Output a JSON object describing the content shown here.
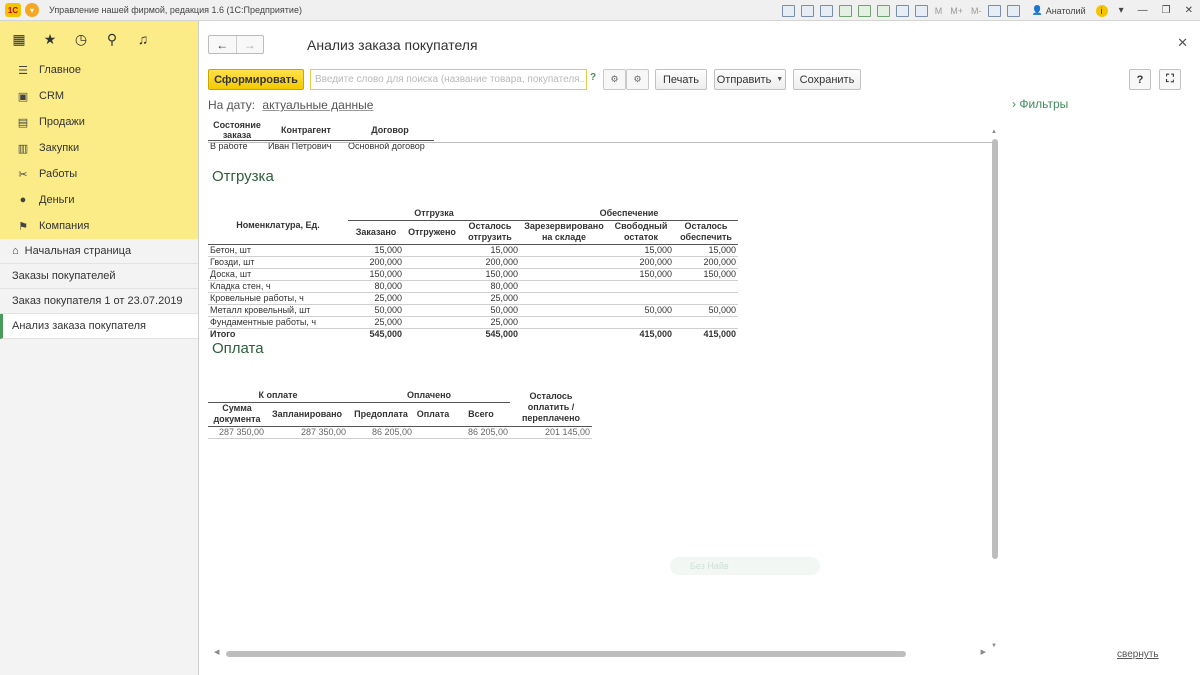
{
  "window": {
    "title": "Управление нашей фирмой, редакция 1.6  (1С:Предприятие)",
    "logo": "1С",
    "user": "Анатолий",
    "m_labels": [
      "M",
      "M+",
      "M-"
    ]
  },
  "sidebar": {
    "items": [
      {
        "label": "Главное",
        "icon": "menu-lines-icon"
      },
      {
        "label": "CRM",
        "icon": "crm-icon"
      },
      {
        "label": "Продажи",
        "icon": "cart-icon"
      },
      {
        "label": "Закупки",
        "icon": "purchases-icon"
      },
      {
        "label": "Работы",
        "icon": "tools-icon"
      },
      {
        "label": "Деньги",
        "icon": "money-icon"
      },
      {
        "label": "Компания",
        "icon": "flag-icon"
      }
    ],
    "nav": [
      {
        "label": "Начальная страница"
      },
      {
        "label": "Заказы покупателей"
      },
      {
        "label": "Заказ покупателя 1 от 23.07.2019"
      },
      {
        "label": "Анализ заказа покупателя"
      }
    ]
  },
  "main": {
    "title": "Анализ заказа покупателя",
    "toolbar": {
      "generate": "Сформировать",
      "search_placeholder": "Введите слово для поиска (название товара, покупателя...",
      "help_mark": "?",
      "print": "Печать",
      "send": "Отправить",
      "save": "Сохранить",
      "help": "?"
    },
    "date_label": "На дату:",
    "date_value": "актуальные данные",
    "filters": "Фильтры",
    "collapse": "свернуть",
    "ghost_text": "Без Найв"
  },
  "report": {
    "header_table": {
      "columns": [
        "Состояние заказа",
        "Контрагент",
        "Договор"
      ],
      "row": [
        "В работе",
        "Иван Петрович",
        "Основной договор"
      ]
    },
    "shipment": {
      "title": "Отгрузка",
      "col_item": "Номенклатура, Ед.",
      "group_shipment": "Отгрузка",
      "group_provision": "Обеспечение",
      "cols": [
        "Заказано",
        "Отгружено",
        "Осталось отгрузить",
        "Зарезервировано на складе",
        "Свободный остаток",
        "Осталось обеспечить"
      ],
      "rows": [
        [
          "Бетон, шт",
          "15,000",
          "",
          "15,000",
          "",
          "15,000",
          "15,000"
        ],
        [
          "Гвозди, шт",
          "200,000",
          "",
          "200,000",
          "",
          "200,000",
          "200,000"
        ],
        [
          "Доска, шт",
          "150,000",
          "",
          "150,000",
          "",
          "150,000",
          "150,000"
        ],
        [
          "Кладка стен, ч",
          "80,000",
          "",
          "80,000",
          "",
          "",
          ""
        ],
        [
          "Кровельные работы, ч",
          "25,000",
          "",
          "25,000",
          "",
          "",
          ""
        ],
        [
          "Металл кровельный, шт",
          "50,000",
          "",
          "50,000",
          "",
          "50,000",
          "50,000"
        ],
        [
          "Фундаментные работы, ч",
          "25,000",
          "",
          "25,000",
          "",
          "",
          ""
        ]
      ],
      "total": [
        "Итого",
        "545,000",
        "",
        "545,000",
        "",
        "415,000",
        "415,000"
      ]
    },
    "payment": {
      "title": "Оплата",
      "group_to_pay": "К оплате",
      "group_paid": "Оплачено",
      "col_remaining": "Осталось оплатить / переплачено",
      "cols": [
        "Сумма документа",
        "Запланировано",
        "Предоплата",
        "Оплата",
        "Всего"
      ],
      "row": [
        "287 350,00",
        "287 350,00",
        "86 205,00",
        "",
        "86 205,00",
        "201 145,00"
      ]
    }
  }
}
